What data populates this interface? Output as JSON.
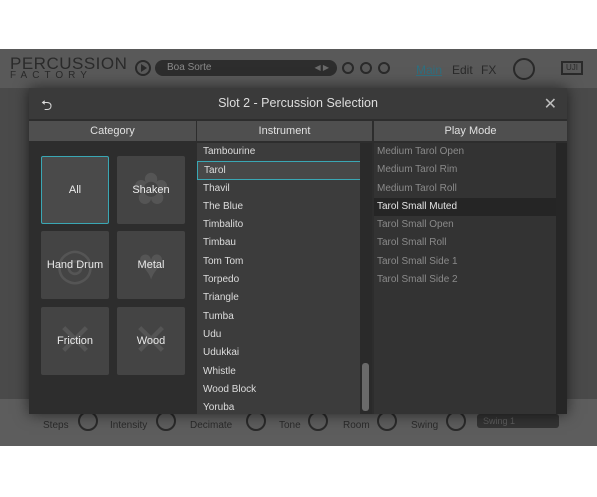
{
  "app": {
    "logo_line1": "PERCUSSION",
    "logo_line2": "FACTORY",
    "preset": "Boa Sorte",
    "tabs": [
      "Main",
      "Edit",
      "FX"
    ],
    "brand": "UJI"
  },
  "bottom": {
    "labels": [
      "Steps",
      "Intensity",
      "Decimate",
      "Tone",
      "Room",
      "Swing"
    ],
    "swing_select": "Swing 1"
  },
  "modal": {
    "title": "Slot 2 - Percussion Selection",
    "back_icon": "back-arrow-icon",
    "close_icon": "close-icon",
    "columns": [
      "Category",
      "Instrument",
      "Play Mode"
    ]
  },
  "categories": [
    {
      "label": "All",
      "selected": true
    },
    {
      "label": "Shaken",
      "selected": false
    },
    {
      "label": "Hand Drum",
      "selected": false
    },
    {
      "label": "Metal",
      "selected": false
    },
    {
      "label": "Friction",
      "selected": false
    },
    {
      "label": "Wood",
      "selected": false
    }
  ],
  "instruments": {
    "items": [
      "Tambourine",
      "Tarol",
      "Thavil",
      "The Blue",
      "Timbalito",
      "Timbau",
      "Tom Tom",
      "Torpedo",
      "Triangle",
      "Tumba",
      "Udu",
      "Udukkai",
      "Whistle",
      "Wood Block",
      "Yoruba"
    ],
    "selected_index": 1
  },
  "play_modes": {
    "items": [
      "Medium Tarol Open",
      "Medium Tarol Rim",
      "Medium Tarol Roll",
      "Tarol Small Muted",
      "Tarol Small Open",
      "Tarol Small Roll",
      "Tarol Small Side 1",
      "Tarol Small Side 2"
    ],
    "selected_index": 3
  },
  "colors": {
    "accent": "#3aa7b4",
    "modal_bg": "#2d2d2d",
    "header_bg": "#4f4f4f"
  }
}
